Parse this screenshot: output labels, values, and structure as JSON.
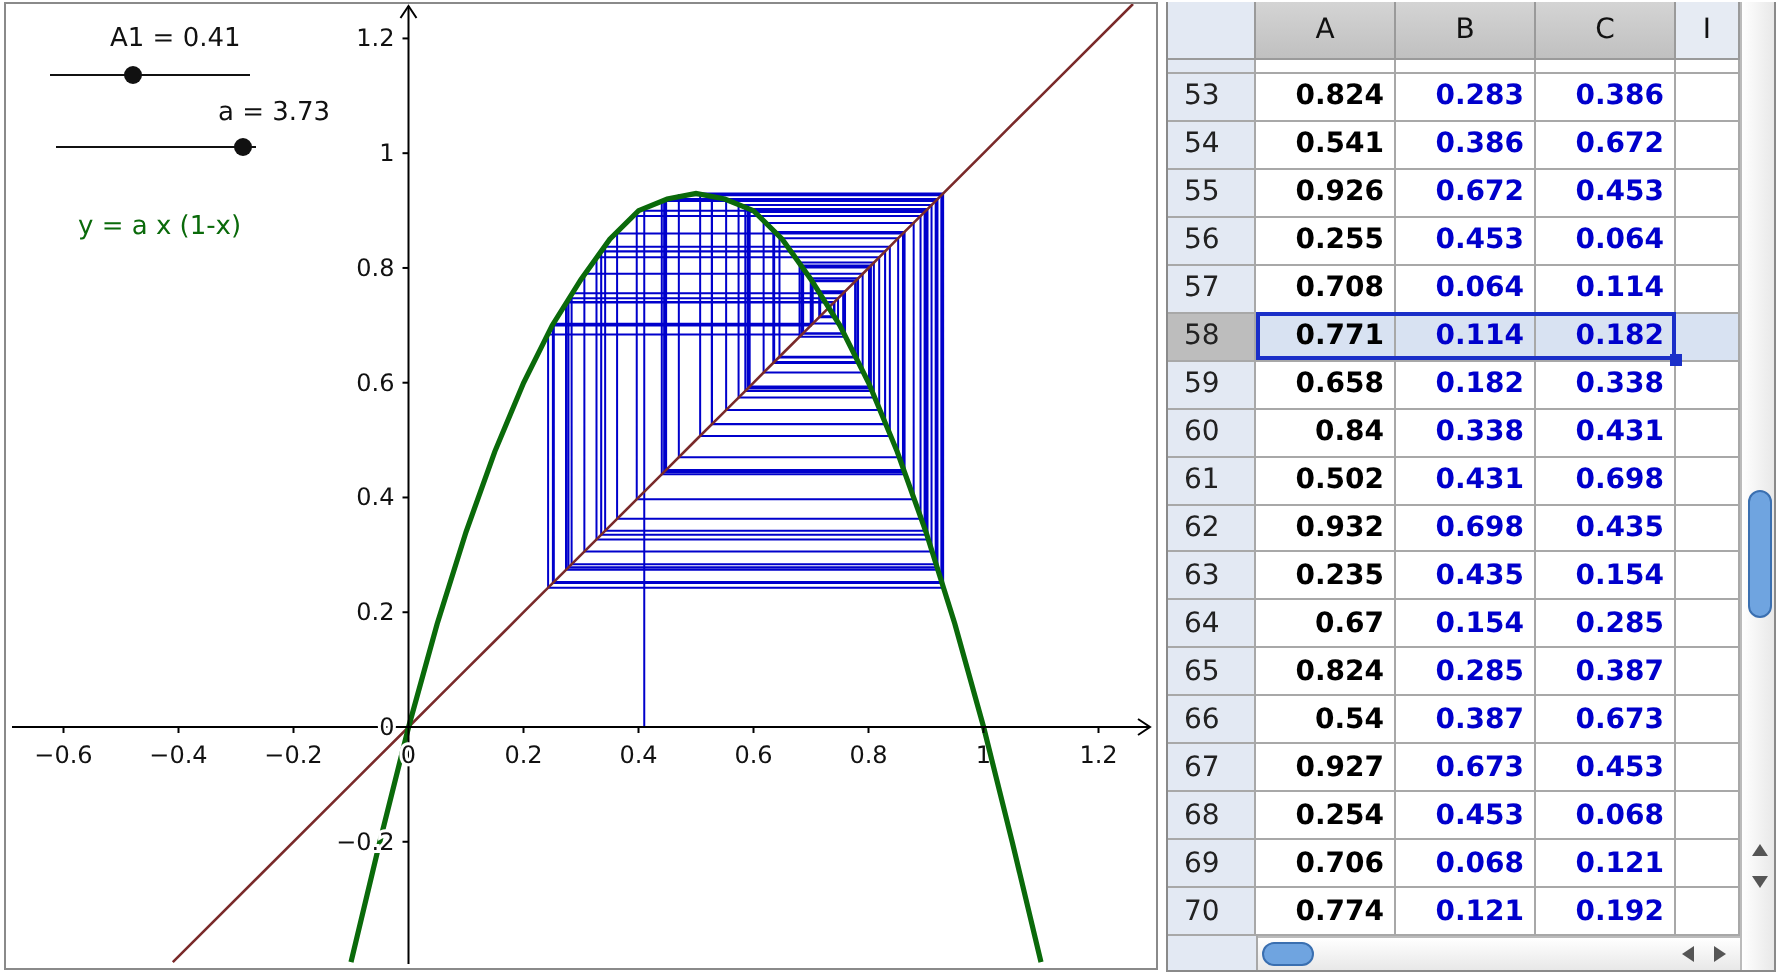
{
  "graphics": {
    "sliders": [
      {
        "label": "A1 = 0.41",
        "level": 0.41
      },
      {
        "label": "a = 3.73",
        "level": 0.93
      }
    ],
    "chart_data": {
      "type": "line",
      "xlim": [
        -0.7,
        1.3
      ],
      "ylim": [
        -0.42,
        1.26
      ],
      "x": [
        -0.41,
        -0.1,
        -0.05,
        0,
        0.05,
        0.1,
        0.15,
        0.2,
        0.25,
        0.3,
        0.35,
        0.4,
        0.45,
        0.5,
        0.55,
        0.6,
        0.65,
        0.7,
        0.75,
        0.8,
        0.85,
        0.9,
        0.95,
        1,
        1.05,
        1.1,
        1.26
      ],
      "series": [
        {
          "name": "y = a x (1-x)",
          "color": "#0a6a0a",
          "values": [
            null,
            -0.41,
            -0.2,
            0,
            0.18,
            0.34,
            0.48,
            0.6,
            0.7,
            0.78,
            0.85,
            0.9,
            0.92,
            0.93,
            0.92,
            0.9,
            0.85,
            0.78,
            0.7,
            0.6,
            0.48,
            0.34,
            0.18,
            0,
            -0.2,
            -0.41,
            null
          ]
        },
        {
          "color": "#7a2a2a",
          "values": [
            -0.41,
            -0.1,
            -0.05,
            0,
            0.05,
            0.1,
            0.15,
            0.2,
            0.25,
            0.3,
            0.35,
            0.4,
            0.45,
            0.5,
            0.55,
            0.6,
            0.65,
            0.7,
            0.75,
            0.8,
            0.85,
            0.9,
            0.95,
            1,
            1.05,
            1.1,
            1.26
          ]
        }
      ],
      "xticks": [
        {
          "value": -0.6,
          "label": "−0.6"
        },
        {
          "value": -0.4,
          "label": "−0.4"
        },
        {
          "value": -0.2,
          "label": "−0.2"
        },
        0,
        0.2,
        0.4,
        0.6,
        0.8,
        1,
        1.2
      ],
      "yticks": [
        {
          "value": -0.2,
          "label": "−0.2"
        },
        0,
        0.2,
        0.4,
        0.6,
        0.8,
        1,
        1.2
      ]
    }
  },
  "spreadsheet": {
    "columns": [
      {
        "header": "A",
        "color": "#000000"
      },
      {
        "header": "B",
        "color": "#0000cc"
      },
      {
        "header": "C",
        "color": "#0000cc"
      },
      {
        "header": "I"
      }
    ],
    "rows": [
      {
        "number": "53",
        "cells": [
          "0.824",
          "0.283",
          "0.386"
        ],
        "selected": false
      },
      {
        "number": "54",
        "cells": [
          "0.541",
          "0.386",
          "0.672"
        ],
        "selected": false
      },
      {
        "number": "55",
        "cells": [
          "0.926",
          "0.672",
          "0.453"
        ],
        "selected": false
      },
      {
        "number": "56",
        "cells": [
          "0.255",
          "0.453",
          "0.064"
        ],
        "selected": false
      },
      {
        "number": "57",
        "cells": [
          "0.708",
          "0.064",
          "0.114"
        ],
        "selected": false
      },
      {
        "number": "58",
        "cells": [
          "0.771",
          "0.114",
          "0.182"
        ],
        "selected": true
      },
      {
        "number": "59",
        "cells": [
          "0.658",
          "0.182",
          "0.338"
        ],
        "selected": false
      },
      {
        "number": "60",
        "cells": [
          "0.84",
          "0.338",
          "0.431"
        ],
        "selected": false
      },
      {
        "number": "61",
        "cells": [
          "0.502",
          "0.431",
          "0.698"
        ],
        "selected": false
      },
      {
        "number": "62",
        "cells": [
          "0.932",
          "0.698",
          "0.435"
        ],
        "selected": false
      },
      {
        "number": "63",
        "cells": [
          "0.235",
          "0.435",
          "0.154"
        ],
        "selected": false
      },
      {
        "number": "64",
        "cells": [
          "0.67",
          "0.154",
          "0.285"
        ],
        "selected": false
      },
      {
        "number": "65",
        "cells": [
          "0.824",
          "0.285",
          "0.387"
        ],
        "selected": false
      },
      {
        "number": "66",
        "cells": [
          "0.54",
          "0.387",
          "0.673"
        ],
        "selected": false
      },
      {
        "number": "67",
        "cells": [
          "0.927",
          "0.673",
          "0.453"
        ],
        "selected": false
      },
      {
        "number": "68",
        "cells": [
          "0.254",
          "0.453",
          "0.068"
        ],
        "selected": false
      },
      {
        "number": "69",
        "cells": [
          "0.706",
          "0.068",
          "0.121"
        ],
        "selected": false
      },
      {
        "number": "70",
        "cells": [
          "0.774",
          "0.121",
          "0.192"
        ],
        "selected": false
      }
    ]
  }
}
